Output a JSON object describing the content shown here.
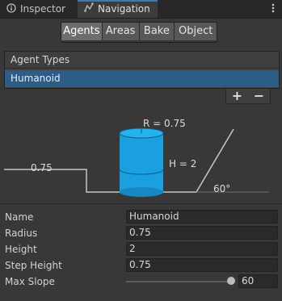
{
  "tabs": [
    {
      "label": "Inspector",
      "icon": "info-icon"
    },
    {
      "label": "Navigation",
      "icon": "navigation-icon",
      "active": true
    }
  ],
  "segments": [
    {
      "label": "Agents",
      "active": true
    },
    {
      "label": "Areas"
    },
    {
      "label": "Bake"
    },
    {
      "label": "Object"
    }
  ],
  "agent_types": {
    "header": "Agent Types",
    "items": [
      "Humanoid"
    ],
    "selected": "Humanoid",
    "add_label": "+",
    "remove_label": "−"
  },
  "diagram": {
    "radius_label": "R = 0.75",
    "height_label": "H = 2",
    "step_label": "0.75",
    "slope_label": "60°"
  },
  "properties": {
    "name": {
      "label": "Name",
      "value": "Humanoid"
    },
    "radius": {
      "label": "Radius",
      "value": "0.75"
    },
    "height": {
      "label": "Height",
      "value": "2"
    },
    "step_height": {
      "label": "Step Height",
      "value": "0.75"
    },
    "max_slope": {
      "label": "Max Slope",
      "value": "60",
      "slider_fraction": 1.0
    }
  },
  "colors": {
    "accent": "#3a79bb",
    "selection": "#2c5d87",
    "cylinder": "#1a9fe0"
  }
}
